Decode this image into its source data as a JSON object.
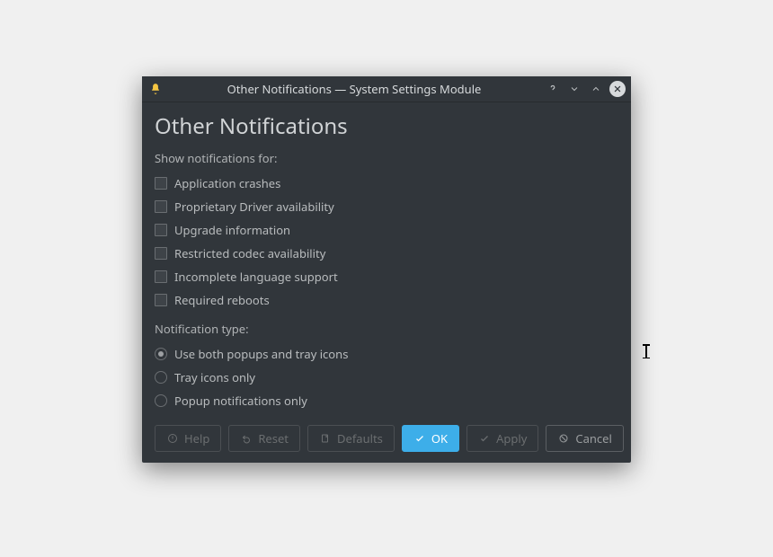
{
  "window": {
    "title": "Other Notifications — System Settings Module"
  },
  "page": {
    "heading": "Other Notifications",
    "show_for_label": "Show notifications for:",
    "options": [
      {
        "label": "Application crashes"
      },
      {
        "label": "Proprietary Driver availability"
      },
      {
        "label": "Upgrade information"
      },
      {
        "label": "Restricted codec availability"
      },
      {
        "label": "Incomplete language support"
      },
      {
        "label": "Required reboots"
      }
    ],
    "type_label": "Notification type:",
    "types": [
      {
        "label": "Use both popups and tray icons",
        "selected": true
      },
      {
        "label": "Tray icons only",
        "selected": false
      },
      {
        "label": "Popup notifications only",
        "selected": false
      }
    ]
  },
  "buttons": {
    "help": "Help",
    "reset": "Reset",
    "defaults": "Defaults",
    "ok": "OK",
    "apply": "Apply",
    "cancel": "Cancel"
  }
}
